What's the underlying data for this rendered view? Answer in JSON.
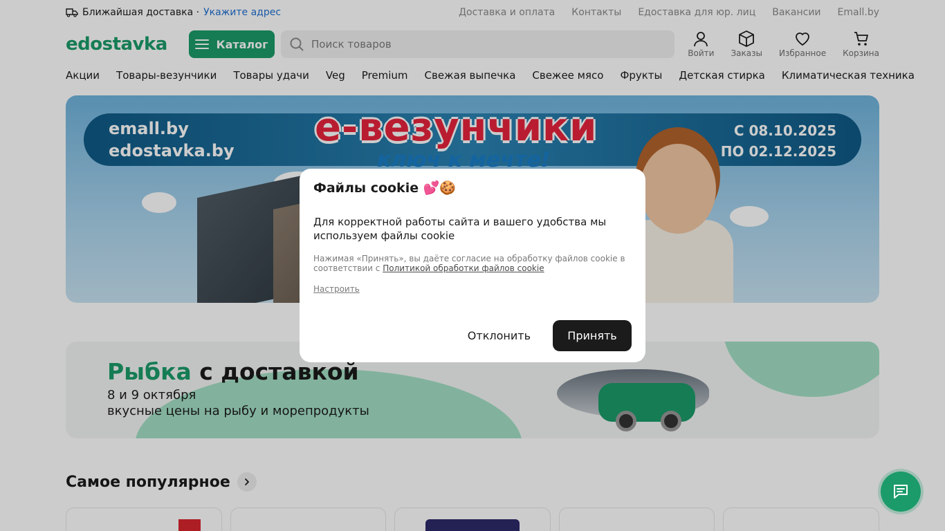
{
  "topbar": {
    "delivery_label": "Ближайшая доставка ·",
    "address_link": "Укажите адрес",
    "links": [
      "Доставка и оплата",
      "Контакты",
      "Едоставка для юр. лиц",
      "Вакансии",
      "Emall.by"
    ]
  },
  "header": {
    "logo": "edostavka",
    "catalog_label": "Каталог",
    "search_placeholder": "Поиск товаров",
    "actions": {
      "login": "Войти",
      "orders": "Заказы",
      "favorites": "Избранное",
      "cart": "Корзина"
    }
  },
  "categories": [
    "Акции",
    "Товары-везунчики",
    "Товары удачи",
    "Veg",
    "Premium",
    "Свежая выпечка",
    "Свежее мясо",
    "Фрукты",
    "Детская стирка",
    "Климатическая техника"
  ],
  "banner1": {
    "left_line1": "emall.by",
    "left_line2": "edostavka.by",
    "title": "e-везунчики",
    "subtitle": "ключ к мечте!",
    "date_from": "С 08.10.2025",
    "date_to": "ПО 02.12.2025"
  },
  "banner2": {
    "title_green": "Рыбка",
    "title_rest": " с доставкой",
    "line1": "8 и 9 октября",
    "line2": "вкусные цены на рыбу и морепродукты"
  },
  "popular": {
    "title": "Самое популярное"
  },
  "cookie_dialog": {
    "title": "Файлы cookie 💕🍪",
    "body": "Для корректной работы сайта и вашего удобства мы используем файлы cookie",
    "fine_prefix": "Нажимая «Принять», вы даёте согласие на обработку файлов cookie в соответствии с ",
    "policy_link": "Политикой обработки файлов cookie",
    "configure": "Настроить",
    "decline": "Отклонить",
    "accept": "Принять"
  },
  "colors": {
    "brand": "#1b9b6a",
    "link": "#1f6fd1",
    "dark_button": "#1b1b1b"
  }
}
